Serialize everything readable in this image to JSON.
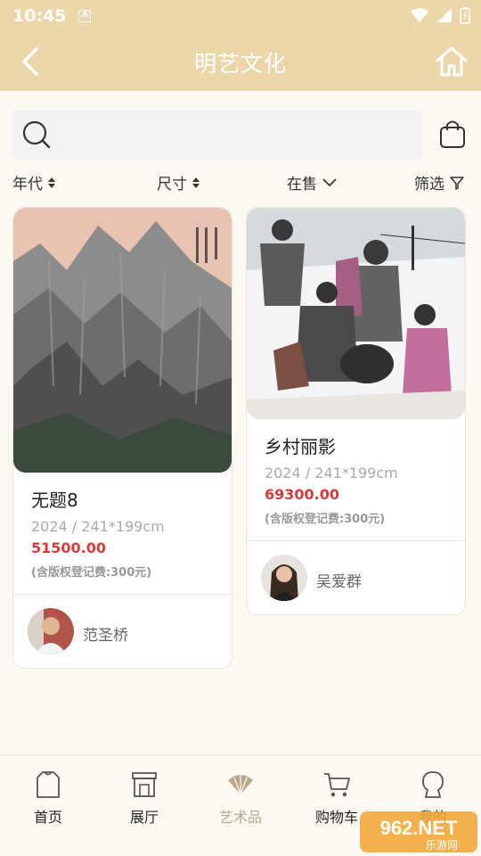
{
  "status": {
    "time": "10:45",
    "notification_icon": "A"
  },
  "header": {
    "title": "明艺文化"
  },
  "search": {
    "placeholder": ""
  },
  "filters": [
    {
      "label": "年代",
      "icon": "sort-icon"
    },
    {
      "label": "尺寸",
      "icon": "sort-icon"
    },
    {
      "label": "在售",
      "icon": "chevron-down-icon"
    },
    {
      "label": "筛选",
      "icon": "filter-icon"
    }
  ],
  "products": [
    {
      "title": "无题8",
      "meta": "2024 / 241*199cm",
      "price": "51500.00",
      "fee": "(含版权登记费:300元)",
      "artist": "范圣桥"
    },
    {
      "title": "乡村丽影",
      "meta": "2024 / 241*199cm",
      "price": "69300.00",
      "fee": "(含版权登记费:300元)",
      "artist": "吴爱群"
    }
  ],
  "tabs": [
    {
      "label": "首页",
      "icon": "home-shirt-icon"
    },
    {
      "label": "展厅",
      "icon": "gallery-icon"
    },
    {
      "label": "艺术品",
      "icon": "fan-icon",
      "active": true
    },
    {
      "label": "购物车",
      "icon": "cart-icon"
    },
    {
      "label": "我的",
      "icon": "profile-icon"
    }
  ],
  "watermark": {
    "text": "962.NET",
    "subtext": "乐游网"
  },
  "colors": {
    "header_bg": "#ecd7aa",
    "price": "#d93b3b",
    "active_tab": "#b9a98a"
  }
}
